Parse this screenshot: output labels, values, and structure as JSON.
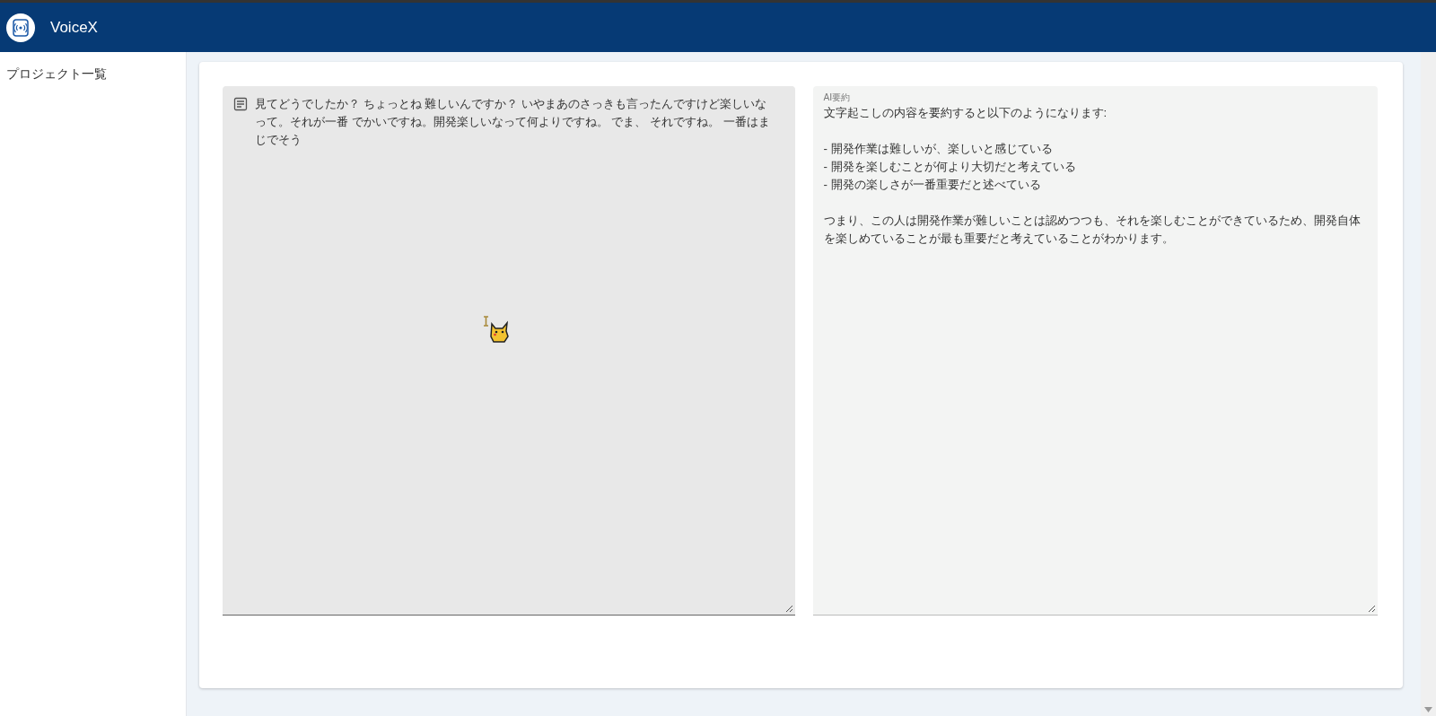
{
  "app_bar": {
    "title": "VoiceX"
  },
  "sidebar": {
    "items": [
      {
        "label": "プロジェクト一覧"
      }
    ]
  },
  "transcript": {
    "value": "見てどうでしたか？ ちょっとね 難しいんですか？ いやまあのさっきも言ったんですけど楽しいなって。それが一番 でかいですね。開発楽しいなって何よりですね。 でま、 それですね。 一番はまじでそう"
  },
  "summary": {
    "label": "AI要約",
    "intro": "文字起こしの内容を要約すると以下のようになります:",
    "bullets": [
      "- 開発作業は難しいが、楽しいと感じている",
      "- 開発を楽しむことが何より大切だと考えている",
      "- 開発の楽しさが一番重要だと述べている"
    ],
    "conclusion": "つまり、この人は開発作業が難しいことは認めつつも、それを楽しむことができているため、開発自体を楽しめていることが最も重要だと考えていることがわかります。"
  }
}
